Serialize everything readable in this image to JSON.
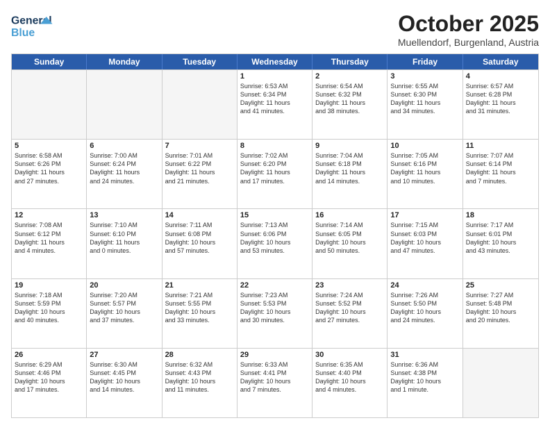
{
  "logo": {
    "line1": "General",
    "line2": "Blue"
  },
  "title": "October 2025",
  "subtitle": "Muellendorf, Burgenland, Austria",
  "weekdays": [
    "Sunday",
    "Monday",
    "Tuesday",
    "Wednesday",
    "Thursday",
    "Friday",
    "Saturday"
  ],
  "rows": [
    [
      {
        "day": "",
        "info": ""
      },
      {
        "day": "",
        "info": ""
      },
      {
        "day": "",
        "info": ""
      },
      {
        "day": "1",
        "info": "Sunrise: 6:53 AM\nSunset: 6:34 PM\nDaylight: 11 hours\nand 41 minutes."
      },
      {
        "day": "2",
        "info": "Sunrise: 6:54 AM\nSunset: 6:32 PM\nDaylight: 11 hours\nand 38 minutes."
      },
      {
        "day": "3",
        "info": "Sunrise: 6:55 AM\nSunset: 6:30 PM\nDaylight: 11 hours\nand 34 minutes."
      },
      {
        "day": "4",
        "info": "Sunrise: 6:57 AM\nSunset: 6:28 PM\nDaylight: 11 hours\nand 31 minutes."
      }
    ],
    [
      {
        "day": "5",
        "info": "Sunrise: 6:58 AM\nSunset: 6:26 PM\nDaylight: 11 hours\nand 27 minutes."
      },
      {
        "day": "6",
        "info": "Sunrise: 7:00 AM\nSunset: 6:24 PM\nDaylight: 11 hours\nand 24 minutes."
      },
      {
        "day": "7",
        "info": "Sunrise: 7:01 AM\nSunset: 6:22 PM\nDaylight: 11 hours\nand 21 minutes."
      },
      {
        "day": "8",
        "info": "Sunrise: 7:02 AM\nSunset: 6:20 PM\nDaylight: 11 hours\nand 17 minutes."
      },
      {
        "day": "9",
        "info": "Sunrise: 7:04 AM\nSunset: 6:18 PM\nDaylight: 11 hours\nand 14 minutes."
      },
      {
        "day": "10",
        "info": "Sunrise: 7:05 AM\nSunset: 6:16 PM\nDaylight: 11 hours\nand 10 minutes."
      },
      {
        "day": "11",
        "info": "Sunrise: 7:07 AM\nSunset: 6:14 PM\nDaylight: 11 hours\nand 7 minutes."
      }
    ],
    [
      {
        "day": "12",
        "info": "Sunrise: 7:08 AM\nSunset: 6:12 PM\nDaylight: 11 hours\nand 4 minutes."
      },
      {
        "day": "13",
        "info": "Sunrise: 7:10 AM\nSunset: 6:10 PM\nDaylight: 11 hours\nand 0 minutes."
      },
      {
        "day": "14",
        "info": "Sunrise: 7:11 AM\nSunset: 6:08 PM\nDaylight: 10 hours\nand 57 minutes."
      },
      {
        "day": "15",
        "info": "Sunrise: 7:13 AM\nSunset: 6:06 PM\nDaylight: 10 hours\nand 53 minutes."
      },
      {
        "day": "16",
        "info": "Sunrise: 7:14 AM\nSunset: 6:05 PM\nDaylight: 10 hours\nand 50 minutes."
      },
      {
        "day": "17",
        "info": "Sunrise: 7:15 AM\nSunset: 6:03 PM\nDaylight: 10 hours\nand 47 minutes."
      },
      {
        "day": "18",
        "info": "Sunrise: 7:17 AM\nSunset: 6:01 PM\nDaylight: 10 hours\nand 43 minutes."
      }
    ],
    [
      {
        "day": "19",
        "info": "Sunrise: 7:18 AM\nSunset: 5:59 PM\nDaylight: 10 hours\nand 40 minutes."
      },
      {
        "day": "20",
        "info": "Sunrise: 7:20 AM\nSunset: 5:57 PM\nDaylight: 10 hours\nand 37 minutes."
      },
      {
        "day": "21",
        "info": "Sunrise: 7:21 AM\nSunset: 5:55 PM\nDaylight: 10 hours\nand 33 minutes."
      },
      {
        "day": "22",
        "info": "Sunrise: 7:23 AM\nSunset: 5:53 PM\nDaylight: 10 hours\nand 30 minutes."
      },
      {
        "day": "23",
        "info": "Sunrise: 7:24 AM\nSunset: 5:52 PM\nDaylight: 10 hours\nand 27 minutes."
      },
      {
        "day": "24",
        "info": "Sunrise: 7:26 AM\nSunset: 5:50 PM\nDaylight: 10 hours\nand 24 minutes."
      },
      {
        "day": "25",
        "info": "Sunrise: 7:27 AM\nSunset: 5:48 PM\nDaylight: 10 hours\nand 20 minutes."
      }
    ],
    [
      {
        "day": "26",
        "info": "Sunrise: 6:29 AM\nSunset: 4:46 PM\nDaylight: 10 hours\nand 17 minutes."
      },
      {
        "day": "27",
        "info": "Sunrise: 6:30 AM\nSunset: 4:45 PM\nDaylight: 10 hours\nand 14 minutes."
      },
      {
        "day": "28",
        "info": "Sunrise: 6:32 AM\nSunset: 4:43 PM\nDaylight: 10 hours\nand 11 minutes."
      },
      {
        "day": "29",
        "info": "Sunrise: 6:33 AM\nSunset: 4:41 PM\nDaylight: 10 hours\nand 7 minutes."
      },
      {
        "day": "30",
        "info": "Sunrise: 6:35 AM\nSunset: 4:40 PM\nDaylight: 10 hours\nand 4 minutes."
      },
      {
        "day": "31",
        "info": "Sunrise: 6:36 AM\nSunset: 4:38 PM\nDaylight: 10 hours\nand 1 minute."
      },
      {
        "day": "",
        "info": ""
      }
    ]
  ]
}
